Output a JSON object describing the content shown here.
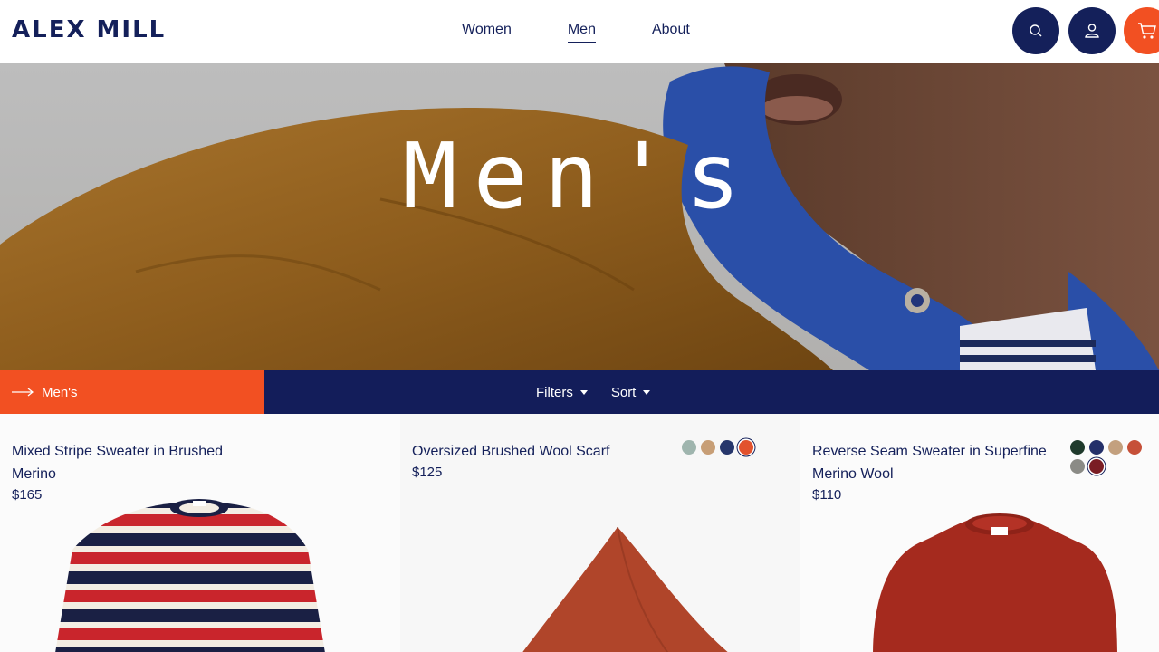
{
  "brand": {
    "logo": "ALEX MILL"
  },
  "nav": {
    "items": [
      "Women",
      "Men",
      "About"
    ],
    "active": "Men"
  },
  "header_icons": [
    "search-icon",
    "account-icon",
    "cart-icon"
  ],
  "hero": {
    "title": "Men's"
  },
  "category_bar": {
    "breadcrumb": "Men's",
    "filters_label": "Filters",
    "sort_label": "Sort"
  },
  "colors": {
    "navy": "#14205a",
    "orange": "#f25022"
  },
  "products": [
    {
      "name": "Mixed Stripe Sweater in Brushed Merino",
      "price": "$165",
      "swatches": []
    },
    {
      "name": "Oversized Brushed Wool Scarf",
      "price": "$125",
      "swatches": [
        "#9fb5ae",
        "#c79e76",
        "#26366b",
        "#e2522d"
      ],
      "selected_swatch": 3
    },
    {
      "name": "Reverse Seam Sweater in Superfine Merino Wool",
      "price": "$110",
      "swatches": [
        "#1f3a2c",
        "#24306a",
        "#c3a07e",
        "#c65038",
        "#8b8b86",
        "#7a1d24"
      ],
      "selected_swatch": 5
    }
  ]
}
